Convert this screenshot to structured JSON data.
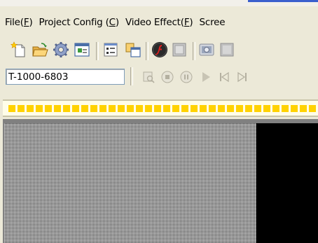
{
  "menu": {
    "items": [
      {
        "label": "File(",
        "mnemonic": "F",
        "suffix": ")"
      },
      {
        "label": "Project Config (",
        "mnemonic": "C",
        "suffix": ")"
      },
      {
        "label": "Video Effect(",
        "mnemonic": "F",
        "suffix": ")"
      },
      {
        "label": "Scree",
        "mnemonic": "",
        "suffix": ""
      }
    ]
  },
  "toolbar": {
    "icons": [
      "new-file-icon",
      "open-folder-icon",
      "settings-gear-icon",
      "properties-icon",
      "program-list-icon",
      "copy-window-icon",
      "flash-icon",
      "stop-square-icon",
      "camera-icon",
      "grey-box-icon"
    ]
  },
  "playback": {
    "device_id": "T-1000-6803",
    "icons": [
      "preview-icon",
      "stop-icon",
      "pause-icon",
      "play-icon",
      "previous-icon",
      "next-icon"
    ]
  },
  "colors": {
    "menubar_bg": "#ece9d8",
    "strip_segment": "#ffd200",
    "display_black": "#000000"
  }
}
